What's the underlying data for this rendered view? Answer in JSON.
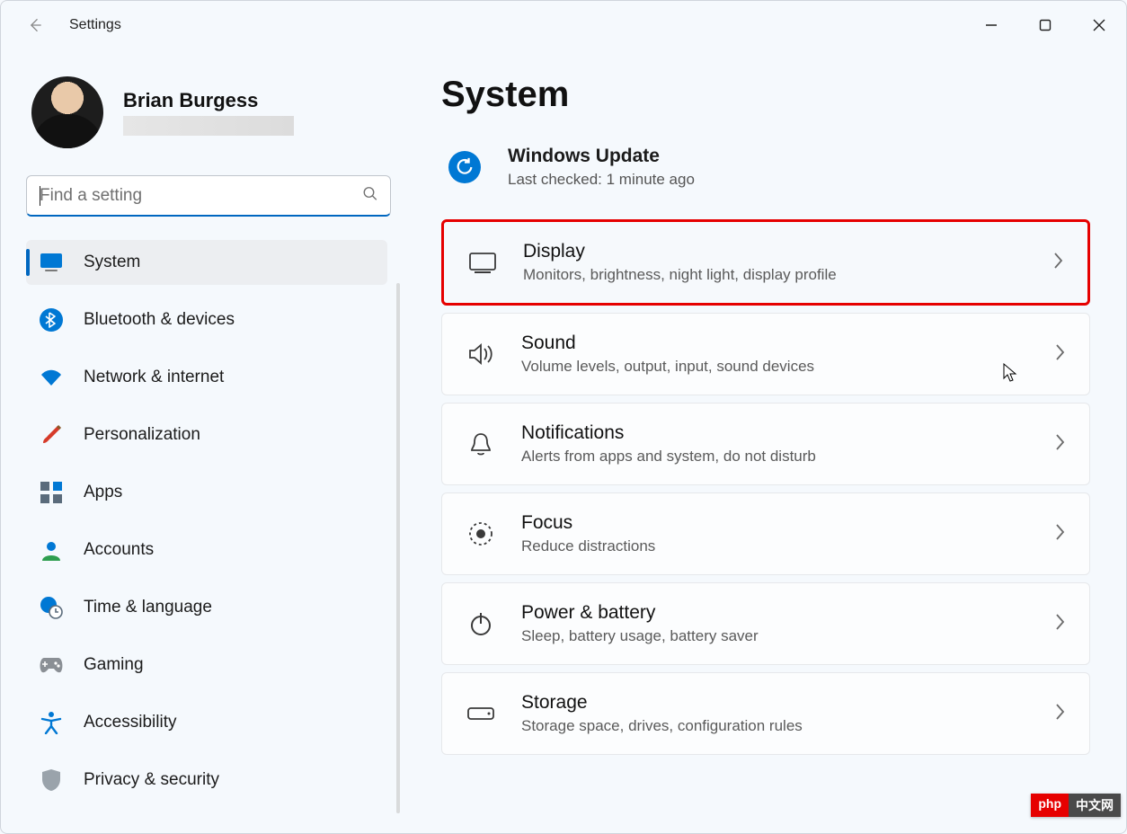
{
  "app_title": "Settings",
  "user": {
    "name": "Brian Burgess"
  },
  "search": {
    "placeholder": "Find a setting"
  },
  "sidebar": {
    "items": [
      {
        "label": "System"
      },
      {
        "label": "Bluetooth & devices"
      },
      {
        "label": "Network & internet"
      },
      {
        "label": "Personalization"
      },
      {
        "label": "Apps"
      },
      {
        "label": "Accounts"
      },
      {
        "label": "Time & language"
      },
      {
        "label": "Gaming"
      },
      {
        "label": "Accessibility"
      },
      {
        "label": "Privacy & security"
      }
    ]
  },
  "page": {
    "heading": "System",
    "update": {
      "title": "Windows Update",
      "sub": "Last checked: 1 minute ago"
    },
    "cards": [
      {
        "title": "Display",
        "sub": "Monitors, brightness, night light, display profile"
      },
      {
        "title": "Sound",
        "sub": "Volume levels, output, input, sound devices"
      },
      {
        "title": "Notifications",
        "sub": "Alerts from apps and system, do not disturb"
      },
      {
        "title": "Focus",
        "sub": "Reduce distractions"
      },
      {
        "title": "Power & battery",
        "sub": "Sleep, battery usage, battery saver"
      },
      {
        "title": "Storage",
        "sub": "Storage space, drives, configuration rules"
      }
    ]
  },
  "watermark": {
    "a": "php",
    "b": "中文网"
  }
}
